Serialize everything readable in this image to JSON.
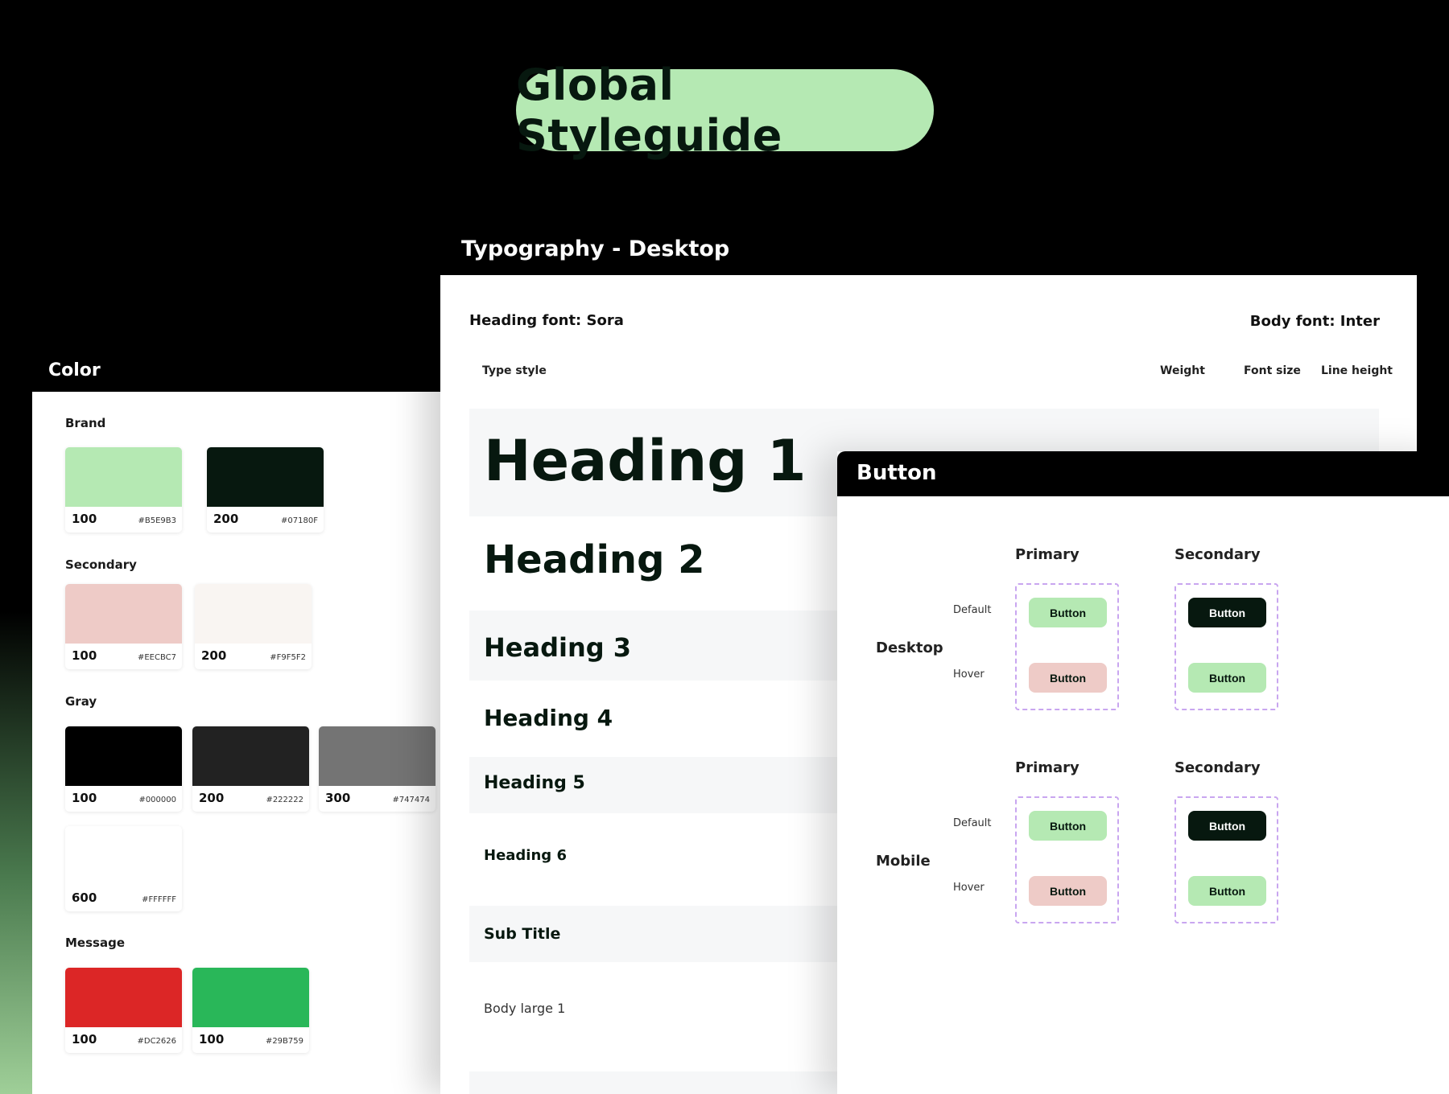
{
  "title": "Global Styleguide",
  "color": {
    "panel_title": "Color",
    "groups": [
      {
        "label": "Brand",
        "swatches": [
          {
            "num": "100",
            "hex": "#B5E9B3"
          },
          {
            "num": "200",
            "hex": "#07180F"
          }
        ]
      },
      {
        "label": "Secondary",
        "swatches": [
          {
            "num": "100",
            "hex": "#EECBC7"
          },
          {
            "num": "200",
            "hex": "#F9F5F2"
          }
        ]
      },
      {
        "label": "Gray",
        "swatches": [
          {
            "num": "100",
            "hex": "#000000"
          },
          {
            "num": "200",
            "hex": "#222222"
          },
          {
            "num": "300",
            "hex": "#747474"
          },
          {
            "num": "600",
            "hex": "#FFFFFF"
          }
        ]
      },
      {
        "label": "Message",
        "swatches": [
          {
            "num": "100",
            "hex": "#DC2626"
          },
          {
            "num": "100",
            "hex": "#29B759"
          }
        ]
      }
    ]
  },
  "typography": {
    "panel_title": "Typography - Desktop",
    "heading_font": "Heading font: Sora",
    "body_font": "Body font: Inter",
    "columns": [
      "Type style",
      "Weight",
      "Font size",
      "Line height"
    ],
    "rows": [
      "Heading 1",
      "Heading 2",
      "Heading 3",
      "Heading 4",
      "Heading 5",
      "Heading 6",
      "Sub Title",
      "Body large 1"
    ]
  },
  "buttons": {
    "panel_title": "Button",
    "col_primary": "Primary",
    "col_secondary": "Secondary",
    "row_desktop": "Desktop",
    "row_mobile": "Mobile",
    "state_default": "Default",
    "state_hover": "Hover",
    "button_label": "Button"
  }
}
